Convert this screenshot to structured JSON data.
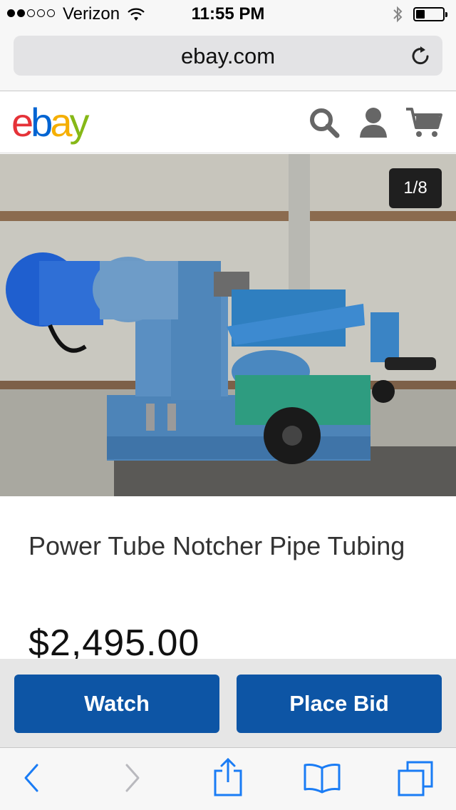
{
  "status_bar": {
    "carrier": "Verizon",
    "time": "11:55 PM",
    "signal_bars_filled": 2,
    "signal_bars_total": 5,
    "battery_level": 0.3
  },
  "browser": {
    "url": "ebay.com",
    "reload_icon": "reload-icon"
  },
  "header": {
    "logo": [
      "e",
      "b",
      "a",
      "y"
    ],
    "logo_colors": [
      "#e53238",
      "#0064d2",
      "#f5af02",
      "#86b817"
    ],
    "icons": [
      "search-icon",
      "user-icon",
      "cart-icon"
    ]
  },
  "listing": {
    "image_counter": "1/8",
    "title": "Power Tube Notcher Pipe Tubing",
    "price": "$2,495.00"
  },
  "actions": {
    "watch_label": "Watch",
    "bid_label": "Place Bid",
    "button_color": "#0d55a5"
  },
  "toolbar": {
    "icons": [
      "back-icon",
      "forward-icon",
      "share-icon",
      "bookmarks-icon",
      "tabs-icon"
    ],
    "accent": "#1a7cf5"
  }
}
